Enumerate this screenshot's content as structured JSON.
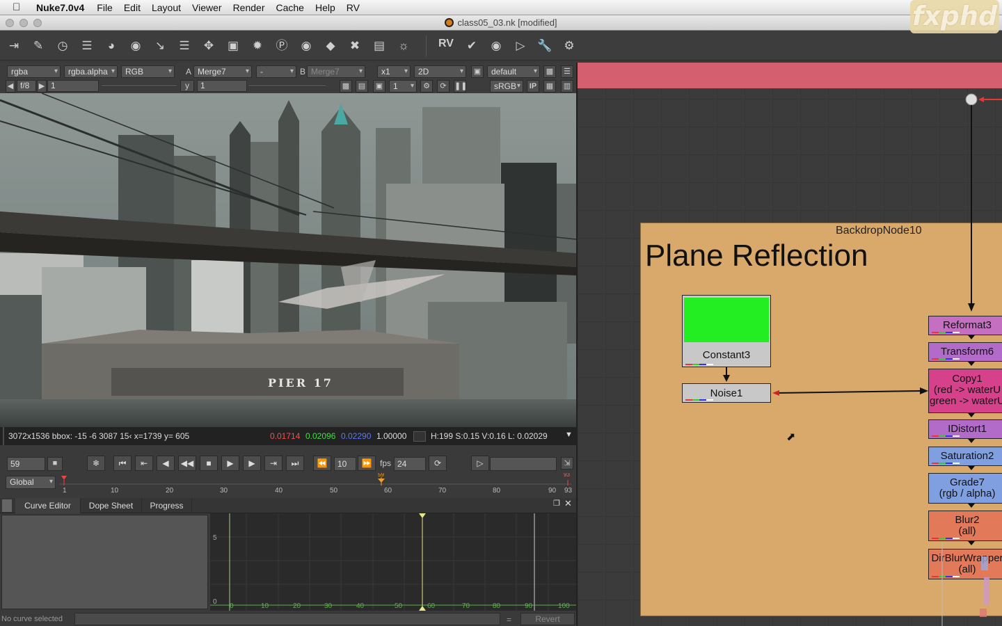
{
  "menubar": {
    "app": "Nuke7.0v4",
    "items": [
      "File",
      "Edit",
      "Layout",
      "Viewer",
      "Render",
      "Cache",
      "Help",
      "RV"
    ]
  },
  "window": {
    "title": "class05_03.nk [modified]",
    "watermark": "fxphd"
  },
  "toolbar": {
    "rv_label": "RV"
  },
  "viewer_controls": {
    "channels": "rgba",
    "alpha_channel": "rgba.alpha",
    "display_channels": "RGB",
    "a_label": "A",
    "a_input": "Merge7",
    "mid": "-",
    "b_label": "B",
    "b_input": "Merge7",
    "downscale": "x1",
    "view_mode": "2D",
    "lut": "default",
    "fstop": "f/8",
    "gain": "1",
    "y_label": "y",
    "gamma": "1",
    "proxy": "1",
    "colorspace": "sRGB",
    "ip_label": "IP"
  },
  "viewer": {
    "sign_text": "PIER 17"
  },
  "status": {
    "info": "3072x1536 bbox: -15 -6 3087 15‹  x=1739 y= 605",
    "r": "0.01714",
    "g": "0.02096",
    "b": "0.02290",
    "a": "1.00000",
    "hsvl": "H:199 S:0.15 V:0.16  L: 0.02029",
    "colors": {
      "r": "#ff4b4b",
      "g": "#44dd44",
      "b": "#5a78ff"
    }
  },
  "timeline": {
    "frame": "59",
    "skip": "10",
    "fps_label": "fps",
    "fps": "24",
    "scope": "Global",
    "ticks": [
      "1",
      "10",
      "20",
      "30",
      "40",
      "50",
      "60",
      "70",
      "80",
      "90",
      "93"
    ],
    "current_marker": "59",
    "end_marker": "93"
  },
  "curve_editor": {
    "tabs": [
      "Curve Editor",
      "Dope Sheet",
      "Progress"
    ],
    "y_ticks": [
      "5",
      "0"
    ],
    "x_ticks": [
      "0",
      "10",
      "20",
      "30",
      "40",
      "50",
      "60",
      "70",
      "80",
      "90",
      "100"
    ],
    "status": "No curve selected",
    "eq": "=",
    "revert": "Revert"
  },
  "node_graph": {
    "backdrop_name": "BackdropNode10",
    "backdrop_title": "Plane Reflection",
    "nodes": {
      "constant": "Constant3",
      "noise": "Noise1",
      "reformat": "Reformat3",
      "transform": "Transform6",
      "copy": {
        "name": "Copy1",
        "line2": "(red -> waterU",
        "line3": "green -> waterU"
      },
      "idistort": "IDistort1",
      "saturation": "Saturation2",
      "grade": {
        "name": "Grade7",
        "line2": "(rgb / alpha)"
      },
      "blur": {
        "name": "Blur2",
        "line2": "(all)"
      },
      "dirblur": {
        "name": "DirBlurWrapper",
        "line2": "(all)"
      }
    }
  }
}
